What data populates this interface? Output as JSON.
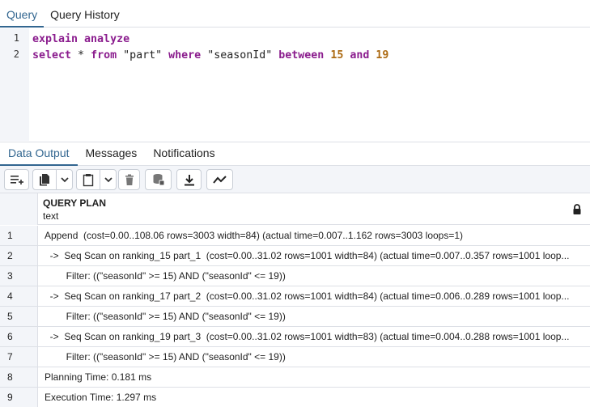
{
  "query_tabs": [
    {
      "label": "Query",
      "active": true
    },
    {
      "label": "Query History",
      "active": false
    }
  ],
  "editor": {
    "lines": [
      {
        "number": "1",
        "tokens": [
          {
            "text": "explain analyze",
            "kind": "kw"
          }
        ]
      },
      {
        "number": "2",
        "tokens": [
          {
            "text": "select",
            "kind": "kw"
          },
          {
            "text": " * ",
            "kind": "op"
          },
          {
            "text": "from",
            "kind": "kw"
          },
          {
            "text": " \"part\" ",
            "kind": "str"
          },
          {
            "text": "where",
            "kind": "kw"
          },
          {
            "text": " \"seasonId\" ",
            "kind": "str"
          },
          {
            "text": "between",
            "kind": "kw"
          },
          {
            "text": " ",
            "kind": "op"
          },
          {
            "text": "15",
            "kind": "num"
          },
          {
            "text": " ",
            "kind": "op"
          },
          {
            "text": "and",
            "kind": "kw"
          },
          {
            "text": " ",
            "kind": "op"
          },
          {
            "text": "19",
            "kind": "num"
          }
        ]
      }
    ]
  },
  "output_tabs": [
    {
      "label": "Data Output",
      "active": true
    },
    {
      "label": "Messages",
      "active": false
    },
    {
      "label": "Notifications",
      "active": false
    }
  ],
  "toolbar": {
    "icons": [
      "add-row-icon",
      "copy-icon",
      "chevron-down-icon",
      "paste-icon",
      "chevron-down-icon",
      "delete-icon",
      "save-data-icon",
      "download-icon",
      "graph-icon"
    ]
  },
  "grid": {
    "column": {
      "name": "QUERY PLAN",
      "type": "text",
      "icon": "lock-icon"
    },
    "rows": [
      {
        "n": "1",
        "text": "Append  (cost=0.00..108.06 rows=3003 width=84) (actual time=0.007..1.162 rows=3003 loops=1)"
      },
      {
        "n": "2",
        "text": "  ->  Seq Scan on ranking_15 part_1  (cost=0.00..31.02 rows=1001 width=84) (actual time=0.007..0.357 rows=1001 loop..."
      },
      {
        "n": "3",
        "text": "        Filter: ((\"seasonId\" >= 15) AND (\"seasonId\" <= 19))"
      },
      {
        "n": "4",
        "text": "  ->  Seq Scan on ranking_17 part_2  (cost=0.00..31.02 rows=1001 width=84) (actual time=0.006..0.289 rows=1001 loop..."
      },
      {
        "n": "5",
        "text": "        Filter: ((\"seasonId\" >= 15) AND (\"seasonId\" <= 19))"
      },
      {
        "n": "6",
        "text": "  ->  Seq Scan on ranking_19 part_3  (cost=0.00..31.02 rows=1001 width=83) (actual time=0.004..0.288 rows=1001 loop..."
      },
      {
        "n": "7",
        "text": "        Filter: ((\"seasonId\" >= 15) AND (\"seasonId\" <= 19))"
      },
      {
        "n": "8",
        "text": "Planning Time: 0.181 ms"
      },
      {
        "n": "9",
        "text": "Execution Time: 1.297 ms"
      }
    ]
  },
  "colors": {
    "accent": "#326690",
    "keyword": "#8b1d8e",
    "number": "#ac6a12"
  }
}
